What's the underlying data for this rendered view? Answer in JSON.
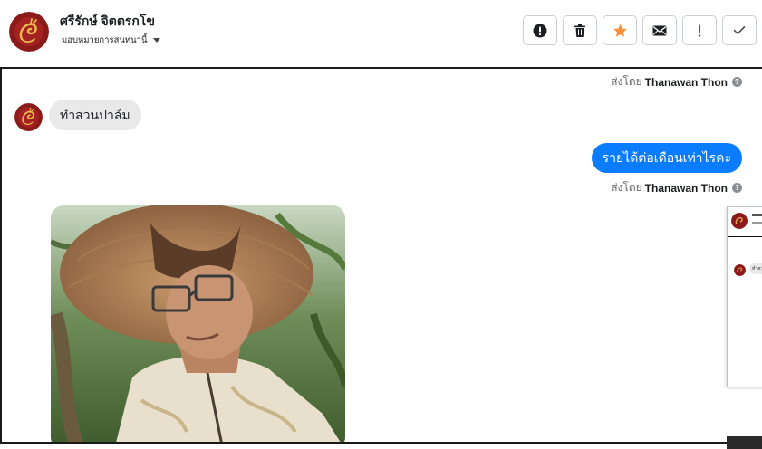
{
  "header": {
    "contact_name": "ศรีรักษ์ จิตตรกโข",
    "assign_label": "มอบหมายการสนทนานี้",
    "avatar_icon": "dragon-emblem-avatar",
    "toolbar": [
      {
        "name": "alert-circle-icon",
        "action": "mark-spam"
      },
      {
        "name": "trash-icon",
        "action": "delete"
      },
      {
        "name": "star-icon",
        "action": "star"
      },
      {
        "name": "envelope-icon",
        "action": "mark-unread"
      },
      {
        "name": "exclamation-icon",
        "action": "follow-up"
      },
      {
        "name": "check-icon",
        "action": "done"
      }
    ]
  },
  "conversation": {
    "sent_by_prefix": "ส่งโดย",
    "sent_by_name": "Thanawan Thon",
    "incoming_message": "ทำสวนปาล์ม",
    "outgoing_message": "รายได้ต่อเดือนเท่าไรคะ",
    "photo": "man-in-straw-hat-photo"
  },
  "mini_window": {
    "bubble_text": "ทำสวน"
  },
  "colors": {
    "outgoing_bubble": "#0a7cff",
    "incoming_bubble": "#e9e9ea",
    "star": "#f7923a",
    "exclamation": "#e02020"
  }
}
